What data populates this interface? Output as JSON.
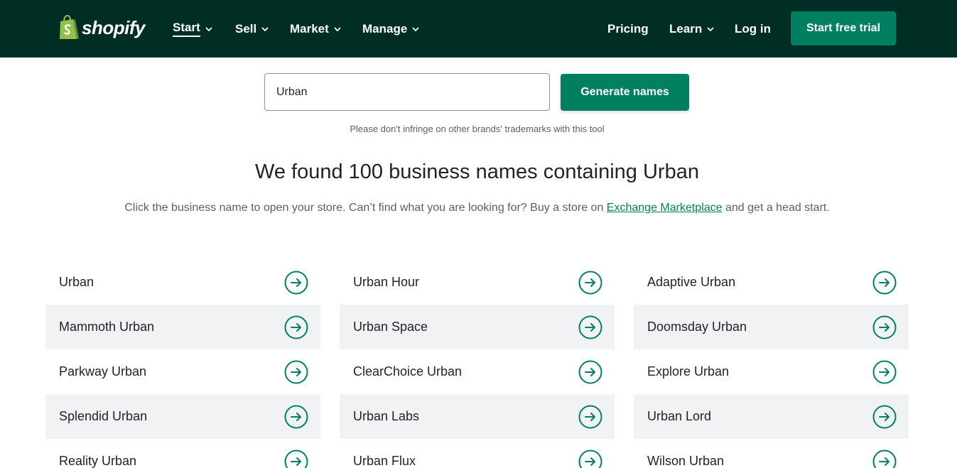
{
  "header": {
    "logo_text": "shopify",
    "nav": [
      {
        "label": "Start",
        "active": true
      },
      {
        "label": "Sell"
      },
      {
        "label": "Market"
      },
      {
        "label": "Manage"
      }
    ],
    "right_nav": {
      "pricing": "Pricing",
      "learn": "Learn",
      "login": "Log in"
    },
    "cta_label": "Start free trial"
  },
  "search": {
    "value": "Urban",
    "button_label": "Generate names",
    "disclaimer": "Please don't infringe on other brands' trademarks with this tool"
  },
  "results": {
    "headline": "We found 100 business names containing Urban",
    "sub_before": "Click the business name to open your store. Can’t find what you are looking for? Buy a store on ",
    "sub_link": "Exchange Marketplace",
    "sub_after": " and get a head start.",
    "columns": [
      [
        "Urban",
        "Mammoth Urban",
        "Parkway Urban",
        "Splendid Urban",
        "Reality Urban"
      ],
      [
        "Urban Hour",
        "Urban Space",
        "ClearChoice Urban",
        "Urban Labs",
        "Urban Flux"
      ],
      [
        "Adaptive Urban",
        "Doomsday Urban",
        "Explore Urban",
        "Urban Lord",
        "Wilson Urban"
      ]
    ]
  },
  "colors": {
    "header_bg": "#002e25",
    "accent": "#008060",
    "row_shade": "#f1f2f3"
  }
}
